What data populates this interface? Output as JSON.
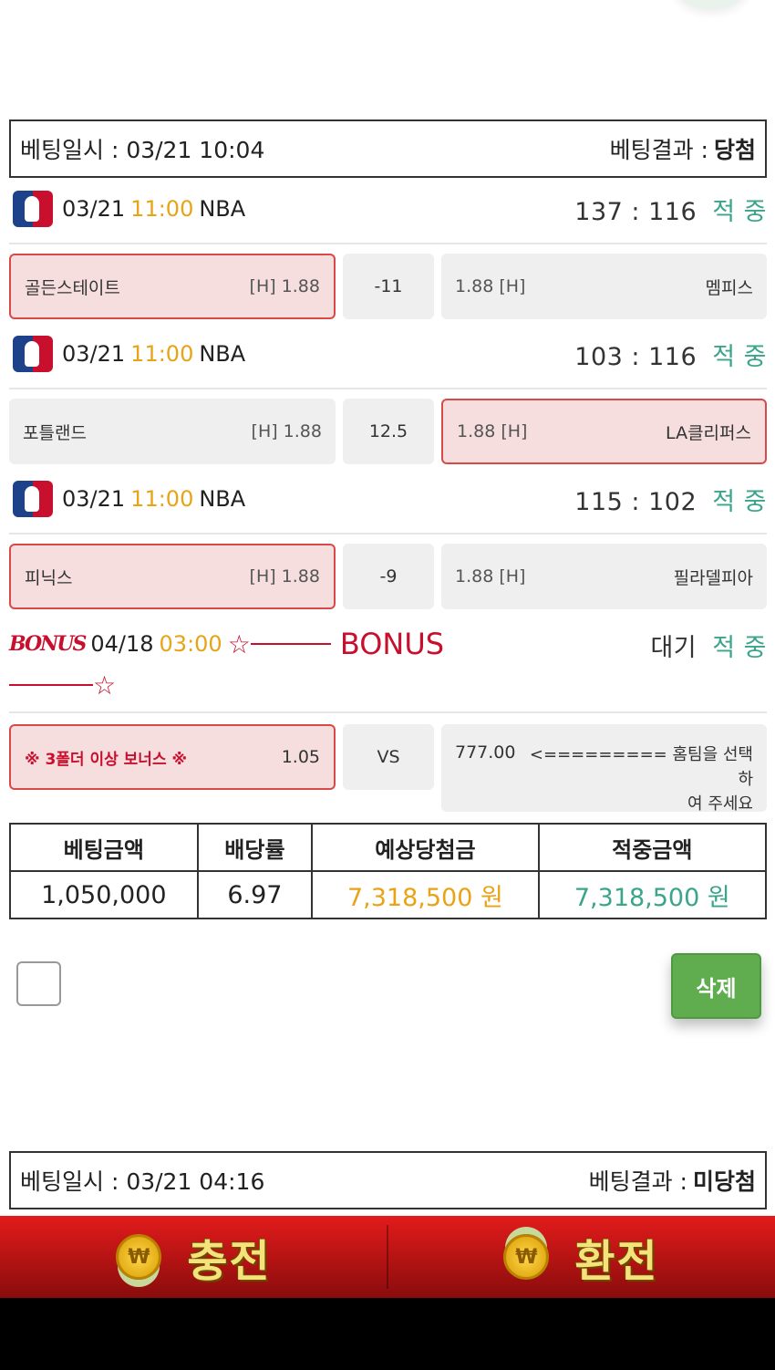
{
  "colors": {
    "time": "#e8a317",
    "hit": "#3aa58a",
    "selected_bg": "#f6dede",
    "selected_border": "#d84a4a",
    "bonus_red": "#c8102e",
    "delete_green": "#5fad4e"
  },
  "bet1": {
    "date_label": "베팅일시 : 03/21 10:04",
    "result_label": "베팅결과 :",
    "result_value": "당첨",
    "games": [
      {
        "date": "03/21",
        "time": "11:00",
        "league": "NBA",
        "score": "137 : 116",
        "status": "적 중",
        "home": "골든스테이트",
        "home_odds": "[H] 1.88",
        "handicap": "-11",
        "away_odds": "1.88 [H]",
        "away": "멤피스",
        "selected": "home"
      },
      {
        "date": "03/21",
        "time": "11:00",
        "league": "NBA",
        "score": "103 : 116",
        "status": "적 중",
        "home": "포틀랜드",
        "home_odds": "[H] 1.88",
        "handicap": "12.5",
        "away_odds": "1.88 [H]",
        "away": "LA클리퍼스",
        "selected": "away"
      },
      {
        "date": "03/21",
        "time": "11:00",
        "league": "NBA",
        "score": "115 : 102",
        "status": "적 중",
        "home": "피닉스",
        "home_odds": "[H] 1.88",
        "handicap": "-9",
        "away_odds": "1.88 [H]",
        "away": "필라델피아",
        "selected": "home"
      }
    ],
    "bonus": {
      "logo": "BONUS",
      "date": "04/18",
      "time": "03:00",
      "title": "BONUS",
      "state": "대기",
      "status": "적 중",
      "home": "※ 3폴더 이상 보너스 ※",
      "home_odds": "1.05",
      "mid": "VS",
      "away_odds": "777.00",
      "away_msg_1": "<========= 홈팀을 선택하",
      "away_msg_2": "여 주세요"
    },
    "summary": {
      "headers": [
        "베팅금액",
        "배당률",
        "예상당첨금",
        "적중금액"
      ],
      "amount": "1,050,000",
      "odds": "6.97",
      "expected": "7,318,500 원",
      "won": "7,318,500 원"
    },
    "delete_label": "삭제"
  },
  "bet2": {
    "date_label": "베팅일시 : 03/21 04:16",
    "result_label": "베팅결과 :",
    "result_value": "미당첨"
  },
  "bottom_bar": {
    "charge_label": "충전",
    "exchange_label": "환전",
    "coin_symbol": "₩"
  }
}
